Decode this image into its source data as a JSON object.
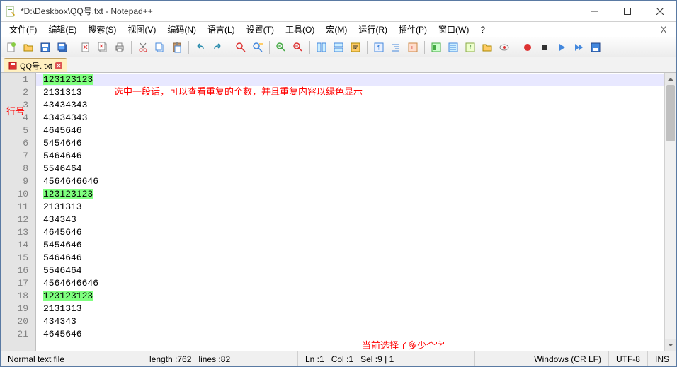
{
  "window": {
    "title": "*D:\\Deskbox\\QQ号.txt - Notepad++"
  },
  "menu": {
    "items": [
      "文件(F)",
      "编辑(E)",
      "搜索(S)",
      "视图(V)",
      "编码(N)",
      "语言(L)",
      "设置(T)",
      "工具(O)",
      "宏(M)",
      "运行(R)",
      "插件(P)",
      "窗口(W)",
      "?"
    ],
    "close_x": "X"
  },
  "tab": {
    "label": "QQ号. txt"
  },
  "lines": [
    {
      "n": 1,
      "text": "123123123",
      "hl": true,
      "current": true
    },
    {
      "n": 2,
      "text": "2131313"
    },
    {
      "n": 3,
      "text": "43434343"
    },
    {
      "n": 4,
      "text": "43434343"
    },
    {
      "n": 5,
      "text": "4645646"
    },
    {
      "n": 6,
      "text": "5454646"
    },
    {
      "n": 7,
      "text": "5464646"
    },
    {
      "n": 8,
      "text": "5546464"
    },
    {
      "n": 9,
      "text": "4564646646"
    },
    {
      "n": 10,
      "text": "123123123",
      "hl": true
    },
    {
      "n": 11,
      "text": "2131313"
    },
    {
      "n": 12,
      "text": "434343"
    },
    {
      "n": 13,
      "text": "4645646"
    },
    {
      "n": 14,
      "text": "5454646"
    },
    {
      "n": 15,
      "text": "5464646"
    },
    {
      "n": 16,
      "text": "5546464"
    },
    {
      "n": 17,
      "text": "4564646646"
    },
    {
      "n": 18,
      "text": "123123123",
      "hl": true
    },
    {
      "n": 19,
      "text": "2131313"
    },
    {
      "n": 20,
      "text": "434343"
    },
    {
      "n": 21,
      "text": "4645646"
    }
  ],
  "annot": {
    "top": "选中一段话，可以查看重复的个数，并且重复内容以绿色显示",
    "line_label": "行号",
    "bottom": "当前选择了多少个字"
  },
  "status": {
    "filetype": "Normal text file",
    "length_label": "length : ",
    "length": "762",
    "lines_label": "lines : ",
    "lines": "82",
    "ln_label": "Ln : ",
    "ln": "1",
    "col_label": "Col : ",
    "col": "1",
    "sel_label": "Sel : ",
    "sel": "9 | 1",
    "eol": "Windows (CR LF)",
    "encoding": "UTF-8",
    "mode": "INS"
  }
}
